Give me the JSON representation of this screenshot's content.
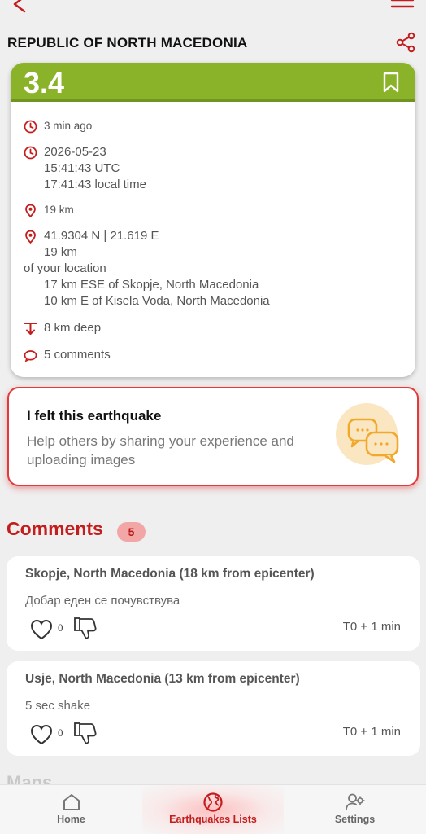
{
  "header": {
    "region_title": "REPUBLIC OF NORTH MACEDONIA"
  },
  "quake": {
    "magnitude": "3.4",
    "magnitude_color": "#8bb32a",
    "time_ago": "3 min ago",
    "date": "2026-05-23",
    "utc_time": "15:41:43 UTC",
    "local_time": "17:41:43 local time",
    "distance_short": "19 km",
    "coordinates": "41.9304 N | 21.619 E",
    "distance_from_you": "19 km",
    "of_your_location": "of your location",
    "nearby_1": "17 km ESE of Skopje, North Macedonia",
    "nearby_2": "10 km E of Kisela Voda, North Macedonia",
    "depth": "8 km deep",
    "comments_count_label": "5 comments"
  },
  "felt": {
    "title": "I felt this earthquake",
    "description": "Help others by sharing your experience and uploading images"
  },
  "comments": {
    "heading": "Comments",
    "count": "5",
    "items": [
      {
        "location": "Skopje, North Macedonia (18 km from epicenter)",
        "text": "Добар еден се почувствува",
        "likes": "0",
        "time": "T0 + 1 min"
      },
      {
        "location": "Usje, North Macedonia (13 km from epicenter)",
        "text": "5 sec shake",
        "likes": "0",
        "time": "T0 + 1 min"
      }
    ]
  },
  "maps_heading": "Maps",
  "nav": {
    "items": [
      {
        "label": "Home",
        "icon": "home-icon"
      },
      {
        "label": "Earthquakes Lists",
        "icon": "globe-icon"
      },
      {
        "label": "Settings",
        "icon": "user-settings-icon"
      }
    ],
    "active_color": "#c41d1d"
  },
  "accent_color": "#c41d1d"
}
